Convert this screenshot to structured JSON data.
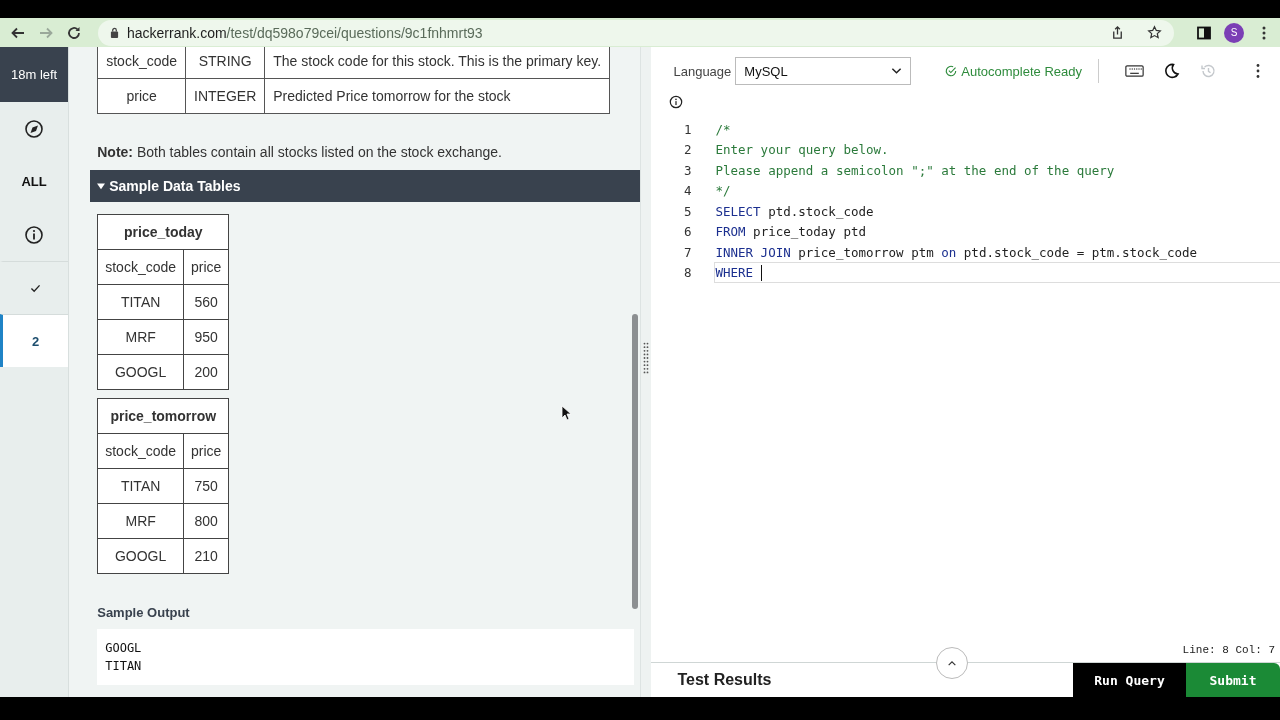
{
  "browser": {
    "url_host": "hackerrank.com",
    "url_path": "/test/dq598o79cei/questions/9c1fnhmrt93",
    "forward_enabled": false,
    "profile_initial": "S"
  },
  "sidebar": {
    "timer": "18m left",
    "filter_label": "ALL",
    "questions": [
      {
        "kind": "done",
        "selected": false
      },
      {
        "kind": "number",
        "label": "2",
        "selected": true
      }
    ]
  },
  "schema_table": {
    "rows": [
      [
        "stock_code",
        "STRING",
        "The stock code for this stock. This is the primary key."
      ],
      [
        "price",
        "INTEGER",
        "Predicted Price tomorrow for the stock"
      ]
    ]
  },
  "note": "**Note:** Both tables contain all stocks listed on the stock exchange.",
  "sample_section": {
    "title": "Sample Data Tables",
    "expanded": true,
    "tables": [
      {
        "title": "price_today",
        "columns": [
          "stock_code",
          "price"
        ],
        "rows": [
          [
            "TITAN",
            "560"
          ],
          [
            "MRF",
            "950"
          ],
          [
            "GOOGL",
            "200"
          ]
        ]
      },
      {
        "title": "price_tomorrow",
        "columns": [
          "stock_code",
          "price"
        ],
        "rows": [
          [
            "TITAN",
            "750"
          ],
          [
            "MRF",
            "800"
          ],
          [
            "GOOGL",
            "210"
          ]
        ]
      }
    ]
  },
  "sample_output": {
    "title": "Sample Output",
    "lines": [
      "GOOGL",
      "TITAN"
    ]
  },
  "editor": {
    "language_label": "Language",
    "language": "MySQL",
    "autocomplete_status": "Autocomplete Ready",
    "lines": [
      {
        "number": "1",
        "current": false,
        "tokens": [
          {
            "kind": "comment",
            "text": "/*"
          }
        ]
      },
      {
        "number": "2",
        "current": false,
        "tokens": [
          {
            "kind": "comment",
            "text": "Enter your query below."
          }
        ]
      },
      {
        "number": "3",
        "current": false,
        "tokens": [
          {
            "kind": "comment",
            "text": "Please append a semicolon \";\" at the end of the query"
          }
        ]
      },
      {
        "number": "4",
        "current": false,
        "tokens": [
          {
            "kind": "comment",
            "text": "*/"
          }
        ]
      },
      {
        "number": "5",
        "current": false,
        "tokens": [
          {
            "kind": "keyword",
            "text": "SELECT"
          },
          {
            "kind": "plain",
            "text": " ptd.stock_code"
          }
        ]
      },
      {
        "number": "6",
        "current": false,
        "tokens": [
          {
            "kind": "keyword",
            "text": "FROM"
          },
          {
            "kind": "plain",
            "text": " price_today ptd"
          }
        ]
      },
      {
        "number": "7",
        "current": false,
        "tokens": [
          {
            "kind": "keyword",
            "text": "INNER JOIN"
          },
          {
            "kind": "plain",
            "text": " price_tomorrow ptm "
          },
          {
            "kind": "keyword",
            "text": "on"
          },
          {
            "kind": "plain",
            "text": " ptd.stock_code = ptm.stock_code"
          }
        ]
      },
      {
        "number": "8",
        "current": true,
        "tokens": [
          {
            "kind": "keyword",
            "text": "WHERE"
          }
        ]
      }
    ],
    "cursor_position": "Line: 8 Col: 7"
  },
  "footer": {
    "test_results": "Test Results",
    "run_button": "Run Query",
    "submit_button": "Submit"
  }
}
